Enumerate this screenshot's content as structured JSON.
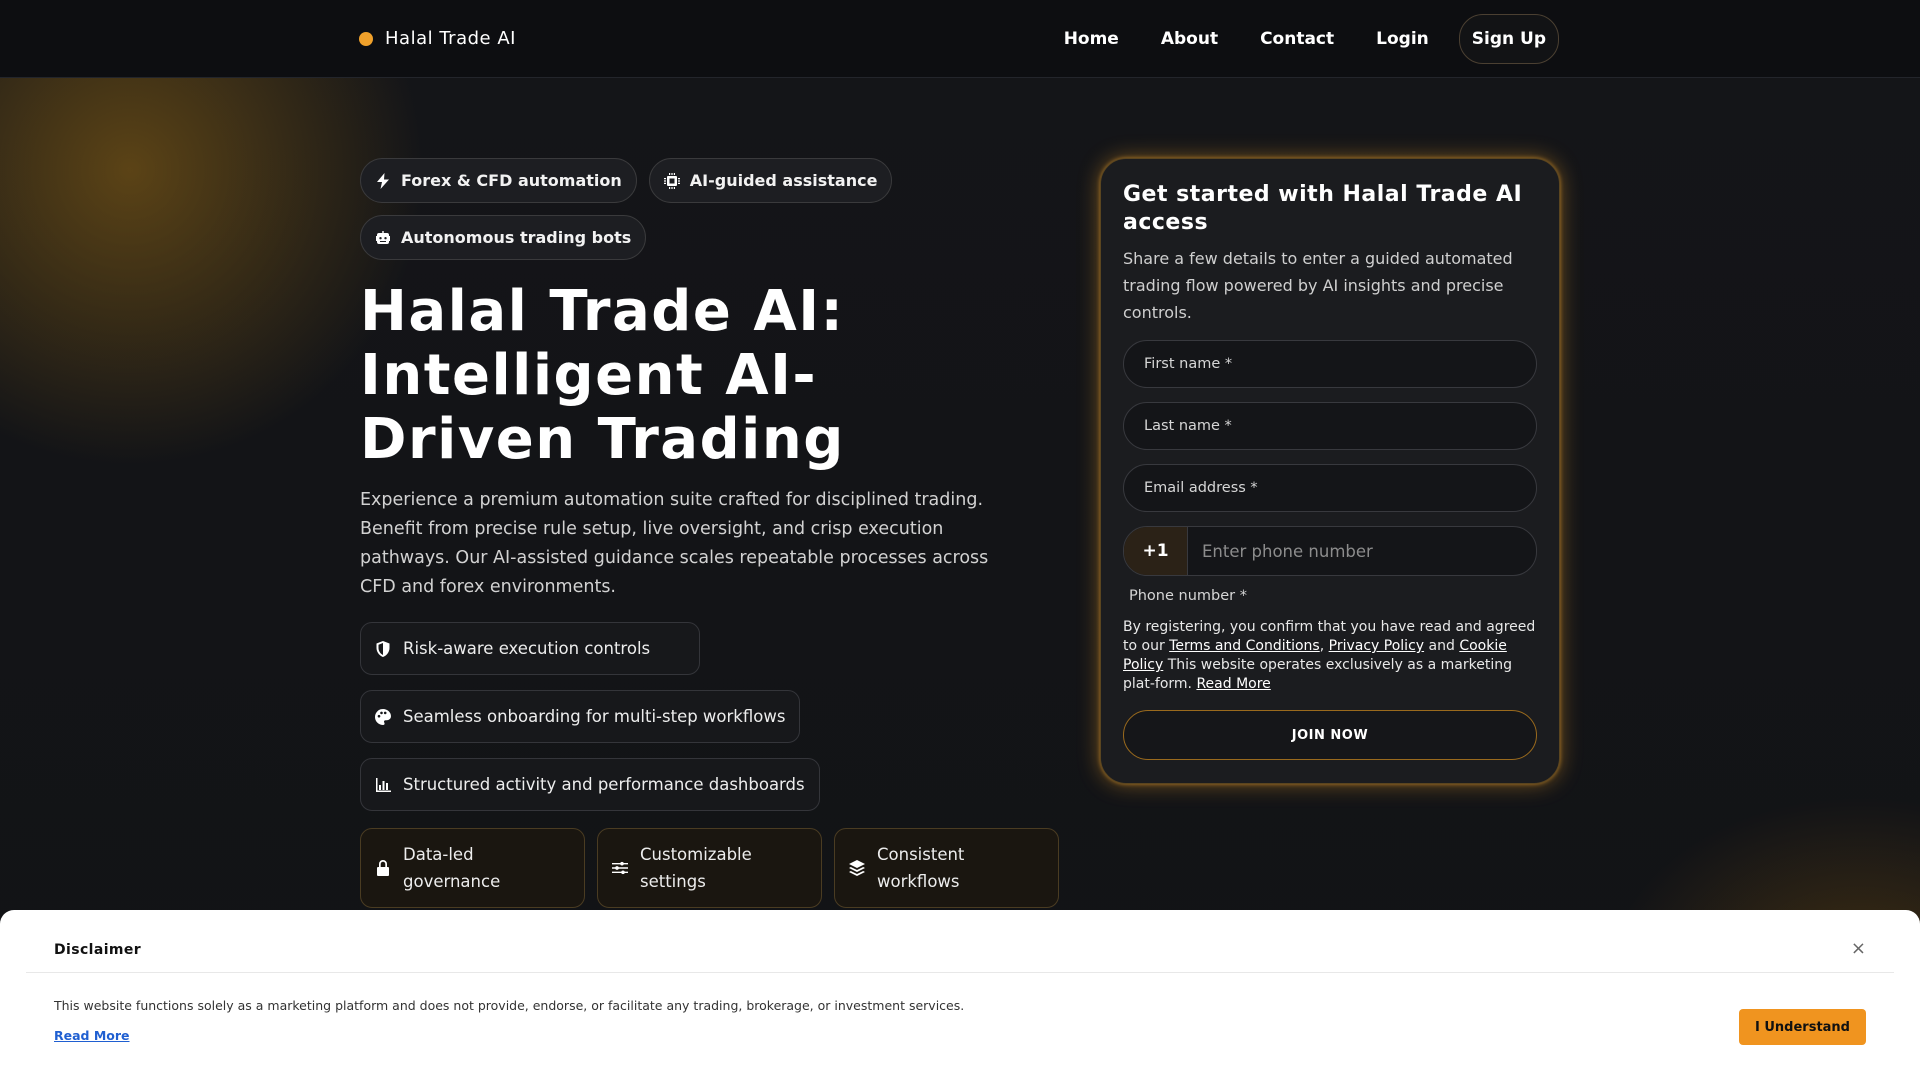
{
  "header": {
    "logo_text": "Halal Trade AI",
    "nav": [
      "Home",
      "About",
      "Contact",
      "Login"
    ],
    "signup_label": "Sign Up"
  },
  "hero": {
    "chips": [
      {
        "icon": "bolt-icon",
        "label": "Forex & CFD automation"
      },
      {
        "icon": "chip-icon",
        "label": "AI-guided assistance"
      },
      {
        "icon": "robot-icon",
        "label": "Autonomous trading bots"
      }
    ],
    "title": "Halal Trade AI: Intelligent AI-Driven Trading",
    "lead": "Experience a premium automation suite crafted for disciplined trading. Benefit from precise rule setup, live oversight, and crisp execution pathways. Our AI-assisted guidance scales repeatable processes across CFD and forex environments.",
    "features": [
      {
        "icon": "shield-icon",
        "label": "Risk-aware execution controls"
      },
      {
        "icon": "palette-icon",
        "label": "Seamless onboarding for multi-step workflows"
      },
      {
        "icon": "bar-chart-icon",
        "label": "Structured activity and performance dashboards"
      }
    ],
    "cards": [
      {
        "icon": "lock-icon",
        "label": "Data-led governance"
      },
      {
        "icon": "sliders-icon",
        "label": "Customizable settings"
      },
      {
        "icon": "layers-icon",
        "label": "Consistent workflows"
      }
    ]
  },
  "form": {
    "title": "Get started with Halal Trade AI access",
    "subtitle": "Share a few details to enter a guided automated trading flow powered by AI insights and precise controls.",
    "first_name": "First name *",
    "last_name": "Last name *",
    "email": "Email address *",
    "country_code": "+1",
    "phone_placeholder": "Enter phone number",
    "phone_label": "Phone number *",
    "legal_prefix": "By registering, you confirm that you have read and agreed to our",
    "terms": "Terms and Conditions",
    "privacy": "Privacy Policy",
    "and": "and",
    "cookie": "Cookie Policy",
    "legal_suffix": "This website operates exclusively as a marketing plat-form.",
    "read_more": "Read More",
    "join_label": "JOIN NOW"
  },
  "disclaimer": {
    "title": "Disclaimer",
    "close": "×",
    "text": "This website functions solely as a marketing platform and does not provide, endorse, or facilitate any trading, brokerage, or investment services.",
    "read_more": "Read More",
    "button": "I Understand"
  },
  "colors": {
    "accent": "#f0a12b",
    "background": "#111215",
    "button": "#f0941f"
  }
}
